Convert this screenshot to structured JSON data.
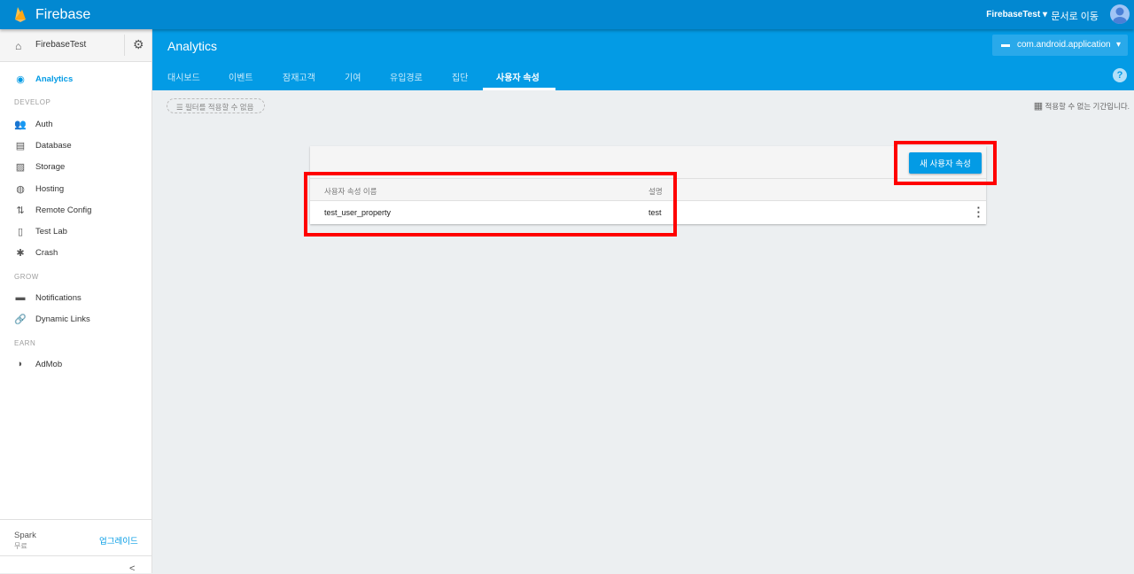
{
  "topbar": {
    "brand": "Firebase",
    "project": "FirebaseTest",
    "docs": "문서로 이동"
  },
  "sidebar": {
    "project": "FirebaseTest",
    "analytics": "Analytics",
    "sections": {
      "develop": "DEVELOP",
      "grow": "GROW",
      "earn": "EARN"
    },
    "develop": [
      "Auth",
      "Database",
      "Storage",
      "Hosting",
      "Remote Config",
      "Test Lab",
      "Crash"
    ],
    "grow": [
      "Notifications",
      "Dynamic Links"
    ],
    "earn": [
      "AdMob"
    ],
    "plan": "Spark",
    "plan_sub": "무료",
    "upgrade": "업그레이드",
    "collapse": "<"
  },
  "header": {
    "title": "Analytics",
    "app": "com.android.application",
    "tabs": [
      "대시보드",
      "이벤트",
      "잠재고객",
      "기여",
      "유입경로",
      "집단",
      "사용자 속성"
    ],
    "active_tab": 6
  },
  "filter": "필터를 적용할 수 없음",
  "period": "적용할 수 없는 기간입니다.",
  "table": {
    "new_button": "새 사용자 속성",
    "columns": [
      "사용자 속성 이름",
      "설명"
    ],
    "rows": [
      {
        "name": "test_user_property",
        "description": "test"
      }
    ]
  },
  "colors": {
    "topbar": "#0288d1",
    "header": "#039be5",
    "highlight": "#ff0000"
  }
}
